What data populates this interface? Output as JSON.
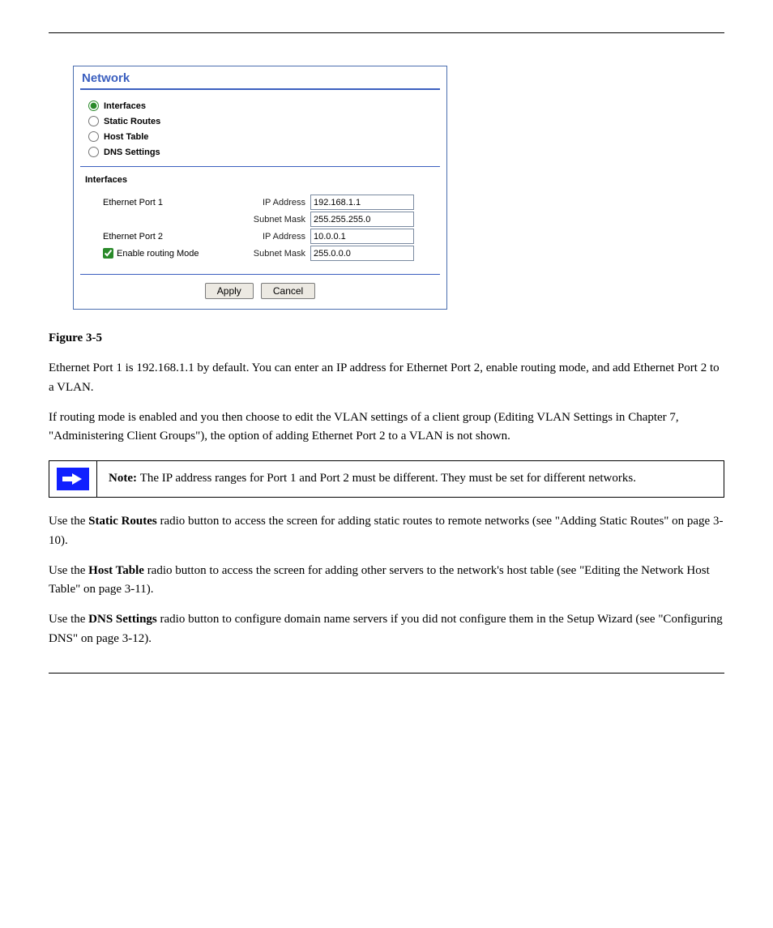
{
  "panel": {
    "title": "Network",
    "radios": {
      "interfaces": "Interfaces",
      "static_routes": "Static Routes",
      "host_table": "Host Table",
      "dns_settings": "DNS Settings"
    },
    "section_title": "Interfaces",
    "port1": {
      "label": "Ethernet Port 1",
      "ip_label": "IP Address",
      "ip_value": "192.168.1.1",
      "mask_label": "Subnet Mask",
      "mask_value": "255.255.255.0"
    },
    "port2": {
      "label": "Ethernet Port 2",
      "ip_label": "IP Address",
      "ip_value": "10.0.0.1",
      "mask_label": "Subnet Mask",
      "mask_value": "255.0.0.0"
    },
    "routing_checkbox": "Enable routing Mode",
    "apply_btn": "Apply",
    "cancel_btn": "Cancel"
  },
  "text": {
    "caption": "Figure 3-5",
    "para1_prefix": "Ethernet Port 1 is ",
    "para1_code": "192.168.1.1",
    "para1_suffix": " by default. You can enter an IP address for Ethernet Port 2, enable routing mode, and add Ethernet Port 2 to a VLAN.",
    "para2_prefix": "If routing mode is enabled and you then choose to edit the VLAN settings of a client group (",
    "para2_link": "Editing VLAN Settings",
    "para2_mid": " in ",
    "para2_chapter": "Chapter 7, \"Administering Client Groups\"",
    "para2_suffix": "), the option of adding Ethernet Port 2 to a VLAN is not shown.",
    "note_bold": "Note: ",
    "note_body": "The IP address ranges for Port 1 and Port 2 must be different. They must be set for different networks.",
    "para3_prefix": "Use the ",
    "para3_static": "Static Routes",
    "para3_mid": " radio button to access the screen for adding static routes to remote networks (see ",
    "para3_link": "\"Adding Static Routes\" on page 3-10",
    "para3_end": ").",
    "para4_prefix": "Use the ",
    "para4_host": "Host Table",
    "para4_mid": " radio button to access the screen for adding other servers to the network's host table (see ",
    "para4_link": "\"Editing the Network Host Table\" on page 3-11",
    "para4_end": ").",
    "para5_prefix": "Use the ",
    "para5_dns": "DNS Settings",
    "para5_mid": " radio button to configure domain name servers if you did not configure them in the Setup Wizard (see ",
    "para5_link": "\"Configuring DNS\" on page 3-12",
    "para5_end": ")."
  }
}
